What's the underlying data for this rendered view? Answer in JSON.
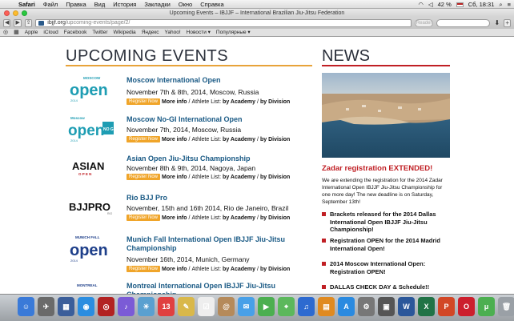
{
  "menubar": {
    "app": "Safari",
    "items": [
      "Файл",
      "Правка",
      "Вид",
      "История",
      "Закладки",
      "Окно",
      "Справка"
    ],
    "battery": "42 %",
    "clock": "Сб, 18:31"
  },
  "window": {
    "title": "Upcoming Events – IBJJF – International Brazilian Jiu-Jitsu Federation"
  },
  "toolbar": {
    "url_host": "ibjjf.org",
    "url_path": "/upcoming-events/page/2/",
    "reader_label": "Reader"
  },
  "bookmarks": [
    "Apple",
    "iCloud",
    "Facebook",
    "Twitter",
    "Wikipedia",
    "Яндекс",
    "Yahoo!",
    "Новости ▾",
    "Популярные ▾"
  ],
  "events_section": {
    "title": "UPCOMING EVENTS"
  },
  "events": [
    {
      "name": "Moscow International Open",
      "date": "November 7th & 8th, 2014, Moscow, Russia",
      "logo_top": "MOSCOW",
      "logo_main": "open",
      "logo_year": "2014"
    },
    {
      "name": "Moscow No-GI International Open",
      "date": "November 7th, 2014, Moscow, Russia",
      "logo_top": "Moscow",
      "logo_main": "open",
      "logo_tag": "NO GI",
      "logo_year": "2014"
    },
    {
      "name": "Asian Open Jiu-Jitsu Championship",
      "date": "November 8th & 9th, 2014, Nagoya, Japan",
      "logo_main": "ASIAN",
      "logo_sub": "O P E N"
    },
    {
      "name": "Rio BJJ Pro",
      "date": "November, 15th and 16th 2014, Rio de Janeiro, Brazil",
      "logo_main": "BJJPRO",
      "logo_tag": "RIO"
    },
    {
      "name": "Munich Fall International Open IBJJF Jiu-Jitsu Championship",
      "date": "November 16th, 2014, Munich, Germany",
      "logo_top": "MUNICH FALL",
      "logo_main": "open",
      "logo_year": "2014"
    },
    {
      "name": "Montreal International Open IBJJF Jiu-Jitsu Championship",
      "logo_top": "MONTREAL"
    }
  ],
  "event_links": {
    "register": "Register Now",
    "more_info": "More info",
    "athlete_list": "Athlete List:",
    "by_academy": "by Academy",
    "by_division": "by Division",
    "sep": "/"
  },
  "news_section": {
    "title": "NEWS",
    "headline": "Zadar registration EXTENDED!",
    "body": "We are extending the registration for the 2014 Zadar International Open IBJJF Jiu-Jitsu Championship for one more day! The new deadline is on Saturday, September 13th!",
    "items": [
      "Brackets released for the 2014 Dallas International Open IBJJF Jiu-Jitsu Championship!",
      "Registration OPEN for the 2014 Madrid International Open!",
      "2014 Moscow International Open: Registration OPEN!",
      "DALLAS CHECK DAY & Schedule!!"
    ]
  },
  "dock": {
    "icons": [
      {
        "name": "finder",
        "glyph": "☺",
        "color": "#3a7ad8"
      },
      {
        "name": "launchpad",
        "glyph": "✈",
        "color": "#6a6a6a"
      },
      {
        "name": "mission-control",
        "glyph": "▦",
        "color": "#3b5e9a"
      },
      {
        "name": "safari",
        "glyph": "◉",
        "color": "#2b8de0"
      },
      {
        "name": "photo-booth",
        "glyph": "◎",
        "color": "#b22222"
      },
      {
        "name": "itunes",
        "glyph": "♪",
        "color": "#7b5bd6"
      },
      {
        "name": "iphoto",
        "glyph": "☀",
        "color": "#5aa0d0"
      },
      {
        "name": "calendar",
        "glyph": "13",
        "color": "#e04040"
      },
      {
        "name": "notes",
        "glyph": "✎",
        "color": "#d9b84a"
      },
      {
        "name": "reminders",
        "glyph": "☑",
        "color": "#eeeeee"
      },
      {
        "name": "contacts",
        "glyph": "@",
        "color": "#b58a5a"
      },
      {
        "name": "messages",
        "glyph": "✉",
        "color": "#48a0e8"
      },
      {
        "name": "facetime",
        "glyph": "▶",
        "color": "#4caf50"
      },
      {
        "name": "maps",
        "glyph": "⌖",
        "color": "#5cb85c"
      },
      {
        "name": "itunes-store",
        "glyph": "♫",
        "color": "#2d6ad0"
      },
      {
        "name": "ibooks",
        "glyph": "▤",
        "color": "#e08a20"
      },
      {
        "name": "app-store",
        "glyph": "A",
        "color": "#2a8ae0"
      },
      {
        "name": "system-preferences",
        "glyph": "⚙",
        "color": "#777777"
      },
      {
        "name": "terminal",
        "glyph": "▣",
        "color": "#555555"
      },
      {
        "name": "word",
        "glyph": "W",
        "color": "#2b579a"
      },
      {
        "name": "excel",
        "glyph": "X",
        "color": "#217346"
      },
      {
        "name": "powerpoint",
        "glyph": "P",
        "color": "#d24726"
      },
      {
        "name": "opera",
        "glyph": "O",
        "color": "#cc1f2d"
      },
      {
        "name": "utorrent",
        "glyph": "μ",
        "color": "#4caf50"
      },
      {
        "name": "trash",
        "glyph": "🗑",
        "color": "#9aa0a6"
      }
    ]
  },
  "colors": {
    "events_rule": "#e8a33a",
    "news_rule": "#c01f24",
    "event_link": "#1a5a85",
    "register_button": "#f0a52a"
  }
}
